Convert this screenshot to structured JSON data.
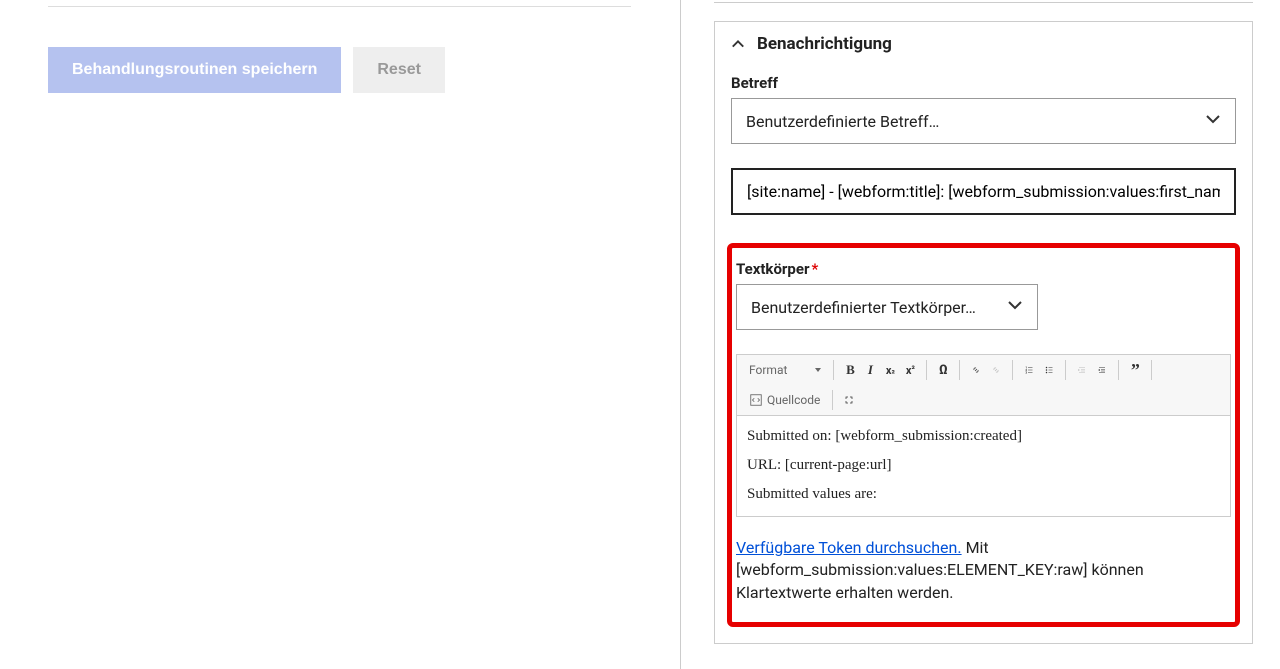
{
  "left": {
    "save_label": "Behandlungsroutinen speichern",
    "reset_label": "Reset"
  },
  "panel": {
    "title": "Benachrichtigung",
    "subject": {
      "label": "Betreff",
      "dropdown_value": "Benutzerdefinierte Betreff…",
      "input_value": "[site:name] - [webform:title]: [webform_submission:values:first_name]"
    },
    "body": {
      "label": "Textkörper",
      "dropdown_value": "Benutzerdefinierter Textkörper…",
      "toolbar": {
        "format": "Format",
        "source": "Quellcode"
      },
      "content_line1": "Submitted on: [webform_submission:created]",
      "content_line2": "URL: [current-page:url]",
      "content_line3": "Submitted values are:",
      "token_link": "Verfügbare Token durchsuchen.",
      "token_help": " Mit [webform_submission:values:ELEMENT_KEY:raw] können Klartextwerte erhalten werden."
    }
  }
}
